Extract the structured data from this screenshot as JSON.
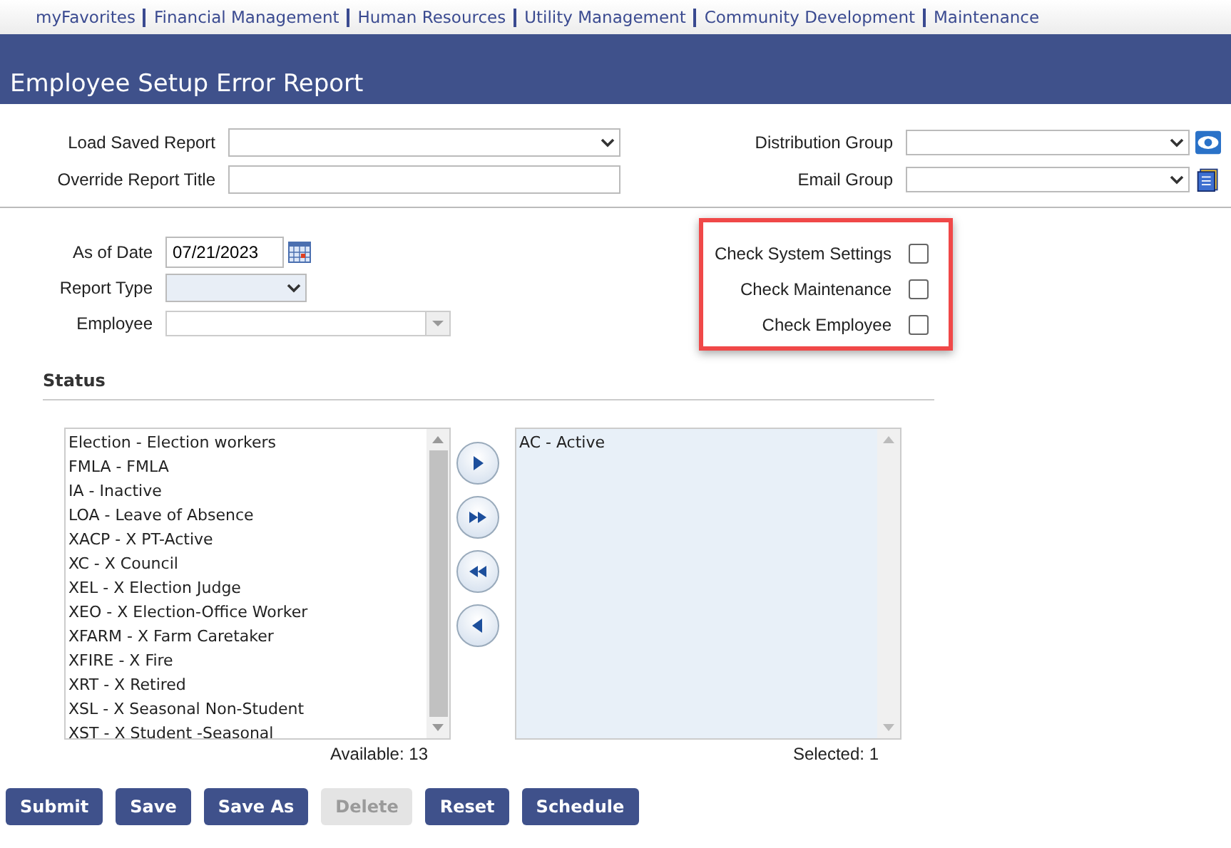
{
  "nav": [
    "myFavorites",
    "Financial Management",
    "Human Resources",
    "Utility Management",
    "Community Development",
    "Maintenance"
  ],
  "title": "Employee Setup Error Report",
  "top_left": [
    {
      "label": "Load Saved Report",
      "kind": "select"
    },
    {
      "label": "Override Report Title",
      "kind": "text"
    }
  ],
  "top_right": [
    {
      "label": "Distribution Group",
      "kind": "eye"
    },
    {
      "label": "Email Group",
      "kind": "book"
    }
  ],
  "as_of_date": {
    "label": "As of Date",
    "value": "07/21/2023"
  },
  "report_type": {
    "label": "Report Type"
  },
  "employee": {
    "label": "Employee"
  },
  "checks": [
    {
      "label": "Check System Settings",
      "checked": false
    },
    {
      "label": "Check Maintenance",
      "checked": false
    },
    {
      "label": "Check Employee",
      "checked": false
    }
  ],
  "status": {
    "heading": "Status",
    "available": [
      "Election - Election workers",
      "FMLA - FMLA",
      "IA - Inactive",
      "LOA - Leave of Absence",
      "XACP - X PT-Active",
      "XC - X Council",
      "XEL - X Election Judge",
      "XEO - X Election-Office Worker",
      "XFARM - X Farm Caretaker",
      "XFIRE - X Fire",
      "XRT - X Retired",
      "XSL - X Seasonal Non-Student",
      "XST - X Student -Seasonal"
    ],
    "selected": [
      "AC - Active"
    ],
    "available_count": "Available: 13",
    "selected_count": "Selected: 1",
    "movers": [
      {
        "kind": "one-right"
      },
      {
        "kind": "all-right"
      },
      {
        "kind": "all-left"
      },
      {
        "kind": "one-left"
      }
    ]
  },
  "buttons": [
    {
      "label": "Submit",
      "disabled": false
    },
    {
      "label": "Save",
      "disabled": false
    },
    {
      "label": "Save As",
      "disabled": false
    },
    {
      "label": "Delete",
      "disabled": true
    },
    {
      "label": "Reset",
      "disabled": false
    },
    {
      "label": "Schedule",
      "disabled": false
    }
  ]
}
